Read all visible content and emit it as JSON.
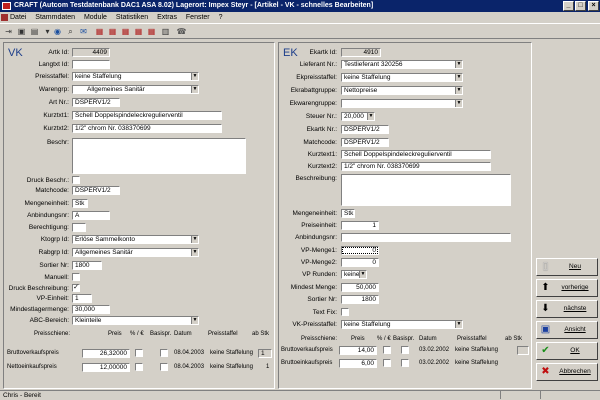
{
  "window": {
    "title": "CRAFT (Autcom Testdatenbank DAC1 ASA 8.02) Lagerort: Impex Steyr - [Artikel - VK - schnelles Bearbeiten]",
    "minimize": "_",
    "maximize": "□",
    "close": "×"
  },
  "menu": [
    "Datei",
    "Stammdaten",
    "Module",
    "Statistiken",
    "Extras",
    "Fenster",
    "?"
  ],
  "vk": {
    "heading": "VK",
    "artikel_id_label": "Artk Id:",
    "artikel_id": "4409",
    "langtxt_label": "Langtxt Id:",
    "langtxt": "",
    "preisstaffel_label": "Preisstaffel:",
    "preisstaffel": "keine Staffelung",
    "warengrp_label": "Warengrp:",
    "warengrp": "Allgemeines Sanitär",
    "artnr_label": "Art Nr.:",
    "artnr": "DSPERV1/2",
    "kurztxt1_label": "Kurztxt1:",
    "kurztxt1": "Schell Doppelspindeleckregulierventil",
    "kurztxt2_label": "Kurztxt2:",
    "kurztxt2": "1/2\" chrom Nr. 038370699",
    "beschr_label": "Beschr:",
    "druck_beschr_label": "Druck Beschr.:",
    "matchcode_label": "Matchcode:",
    "matchcode": "DSPERV1/2",
    "mengeneinheit_label": "Mengeneinheit:",
    "mengeneinheit": "Stk",
    "anbindungsnr_label": "Anbindungsnr:",
    "anbindungsnr": "A",
    "berechtigung_label": "Berechtigung:",
    "berechtigung": "",
    "ktogrp_label": "Ktogrp Id:",
    "ktogrp": "Erlöse Sammelkonto",
    "rabgrp_label": "Rabgrp Id:",
    "rabgrp": "Allgemeines Sanitär",
    "sortier_label": "Sortier Nr:",
    "sortier": "1800",
    "manuell_label": "Manuell:",
    "druck_beschreibung_label": "Druck Beschreibung:",
    "druck_beschreibung_check": "✓",
    "vp_einheit_label": "VP-Einheit:",
    "vp_einheit": "1",
    "mindest_label": "Mindestlagermenge:",
    "mindest": "30,000",
    "abc_label": "ABC-Bereich:",
    "abc": "Kleinteile",
    "grid_headers": {
      "preisschiene": "Preisschiene:",
      "preis": "Preis",
      "proz": "% / €",
      "basispr": "Basispr.",
      "datum": "Datum",
      "preisstaffel": "Preisstaffel",
      "abstk": "ab Stk"
    },
    "rows": [
      {
        "name": "Bruttoverkaufspreis",
        "preis": "26,32000",
        "datum": "08.04.2003",
        "staffel": "keine Staffelung",
        "abstk": "1"
      },
      {
        "name": "Nettoeinkaufspreis",
        "preis": "12,00000",
        "datum": "08.04.2003",
        "staffel": "keine Staffelung",
        "abstk": "1"
      }
    ]
  },
  "ek": {
    "heading": "EK",
    "ekartk_id_label": "Ekartk Id:",
    "ekartk_id": "4910",
    "lieferant_label": "Lieferant Nr.:",
    "lieferant": "Testlieferant 320256",
    "ekpreisstaffel_label": "Ekpreisstaffel:",
    "ekpreisstaffel": "keine Staffelung",
    "ekrabatt_label": "Ekrabattgruppe:",
    "ekrabatt": "Nettopreise",
    "ekwaren_label": "Ekwarengruppe:",
    "ekwaren": "",
    "steuer_label": "Steuer Nr.:",
    "steuer": "20,000",
    "ekartk_nr_label": "Ekartk Nr.:",
    "ekartk_nr": "DSPERV1/2",
    "matchcode_label": "Matchcode:",
    "matchcode": "DSPERV1/2",
    "kurztext1_label": "Kurztext1:",
    "kurztext1": "Schell Doppelspindeleckregulierventil",
    "kurztext2_label": "Kurztext2:",
    "kurztext2": "1/2\" chrom Nr. 038370699",
    "beschreibung_label": "Beschreibung:",
    "mengeneinheit_label": "Mengeneinheit:",
    "mengeneinheit": "Stk",
    "preiseinheit_label": "Preiseinheit:",
    "preiseinheit": "1",
    "anbindungsnr_label": "Anbindungsnr:",
    "anbindungsnr": "",
    "vp_menge1_label": "VP-Menge1:",
    "vp_menge1": "0",
    "vp_menge2_label": "VP-Menge2:",
    "vp_menge2": "0",
    "vp_runden_label": "VP Runden:",
    "vp_runden": "keine",
    "mindest_label": "Mindest Menge:",
    "mindest": "50,000",
    "sortier_label": "Sortier Nr:",
    "sortier": "1800",
    "textfix_label": "Text Fix:",
    "vk_preisstaffel_label": "VK-Preisstaffel:",
    "vk_preisstaffel": "keine Staffelung",
    "grid_headers": {
      "preisschiene": "Preisschiene:",
      "preis": "Preis",
      "proz": "% / €",
      "basispr": "Basispr.",
      "datum": "Datum",
      "preisstaffel": "Preisstaffel",
      "abstk": "ab Stk"
    },
    "rows": [
      {
        "name": "Bruttoverkaufspreis",
        "preis": "14,00",
        "datum": "03.02.2002",
        "staffel": "keine Staffelung",
        "abstk": ""
      },
      {
        "name": "Bruttoeinkaufspreis",
        "preis": "6,00",
        "datum": "03.02.2002",
        "staffel": "keine Staffelung",
        "abstk": ""
      }
    ]
  },
  "side_buttons": {
    "neu": "Neu",
    "vorherige": "vorherige",
    "naechste": "nächste",
    "ansicht": "Ansicht",
    "ok": "OK",
    "abbrechen": "Abbrechen"
  },
  "status": "Chris - Bereit"
}
